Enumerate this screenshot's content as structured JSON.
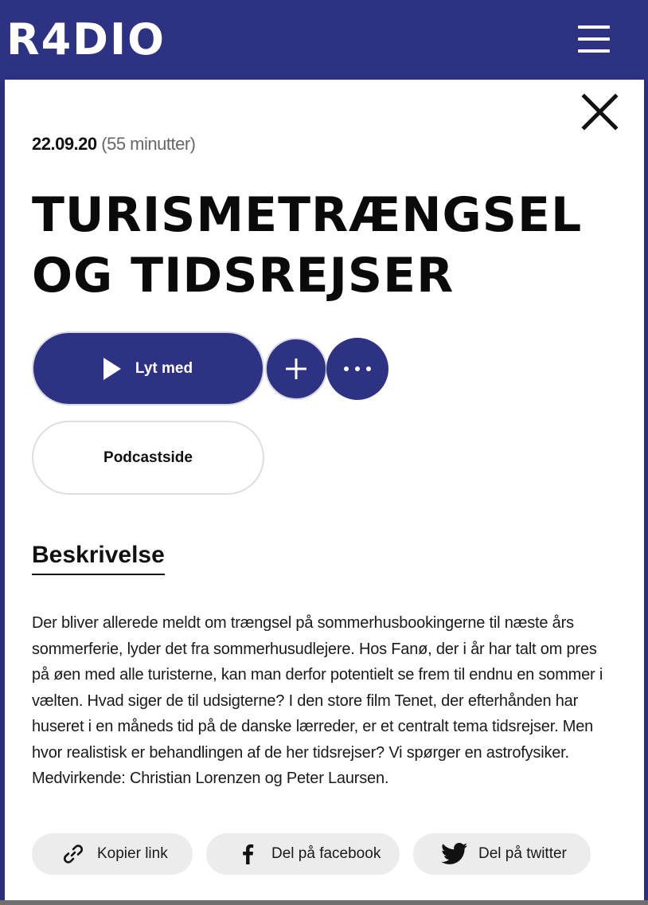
{
  "header": {
    "logo": "R4DIO",
    "menu_icon": "hamburger-menu-icon"
  },
  "episode": {
    "date": "22.09.20",
    "duration": "(55 minutter)",
    "title_line1": "TURISMETRÆNGSEL",
    "title_line2": "OG TIDSREJSER"
  },
  "actions": {
    "play_label": "Lyt med",
    "add_icon": "plus-icon",
    "more_icon": "more-dots-icon",
    "podcast_label": "Podcastside"
  },
  "description": {
    "heading": "Beskrivelse",
    "text": "Der bliver allerede meldt om trængsel på sommerhusbookingerne til næste års sommerferie, lyder det fra sommerhusudlejere. Hos Fanø, der i år har talt om pres på øen med alle turisterne, kan man derfor potentielt se frem til endnu en sommer i vælten. Hvad siger de til udsigterne? I den store film Tenet, der efterhånden har huseret i en måneds tid på de danske lærreder, er et centralt tema tidsrejser. Men hvor realistisk er behandlingen af de her tidsrejser? Vi spørger en astrofysiker. Medvirkende: Christian Lorenzen og Peter Laursen."
  },
  "share": {
    "copy_label": "Kopier link",
    "facebook_label": "Del på facebook",
    "twitter_label": "Del på twitter"
  },
  "colors": {
    "brand": "#2d3282",
    "share_bg": "#ececec"
  }
}
